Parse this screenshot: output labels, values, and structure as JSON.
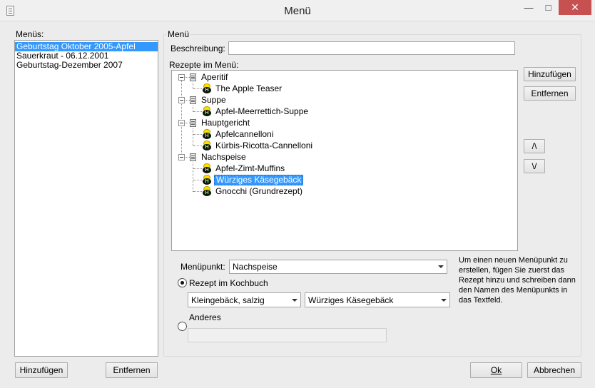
{
  "window": {
    "title": "Menü"
  },
  "menus": {
    "label": "Menüs:",
    "items": [
      {
        "label": "Geburtstag Oktober 2005-Apfel",
        "selected": true
      },
      {
        "label": "Sauerkraut - 06.12.2001",
        "selected": false
      },
      {
        "label": "Geburtstag-Dezember 2007",
        "selected": false
      }
    ],
    "add_label": "Hinzufügen",
    "remove_label": "Entfernen"
  },
  "menu_group": {
    "title": "Menü",
    "description_label": "Beschreibung:",
    "description_value": "",
    "recipes_label": "Rezepte im Menü:",
    "tree": [
      {
        "category": "Aperitif",
        "recipes": [
          {
            "name": "The Apple Teaser",
            "selected": false
          }
        ]
      },
      {
        "category": "Suppe",
        "recipes": [
          {
            "name": "Apfel-Meerrettich-Suppe",
            "selected": false
          }
        ]
      },
      {
        "category": "Hauptgericht",
        "recipes": [
          {
            "name": "Apfelcannelloni",
            "selected": false
          },
          {
            "name": "Kürbis-Ricotta-Cannelloni",
            "selected": false
          }
        ]
      },
      {
        "category": "Nachspeise",
        "recipes": [
          {
            "name": "Apfel-Zimt-Muffins",
            "selected": false
          },
          {
            "name": "Würziges Käsegebäck",
            "selected": true
          },
          {
            "name": "Gnocchi (Grundrezept)",
            "selected": false
          }
        ]
      }
    ],
    "add_label": "Hinzufügen",
    "remove_label": "Entfernen",
    "up_label": "/\\",
    "down_label": "\\/"
  },
  "menu_item": {
    "label": "Menüpunkt:",
    "value": "Nachspeise",
    "help_text": "Um einen neuen Menüpunkt zu erstellen, fügen Sie zuerst das Rezept hinzu und schreiben dann den Namen des Menüpunkts in das Textfeld.",
    "cookbook_option_label": "Rezept im Kochbuch",
    "cookbook_selected": true,
    "category_value": "Kleingebäck, salzig",
    "recipe_value": "Würziges Käsegebäck",
    "other_option_label": "Anderes",
    "other_selected": false,
    "other_value": ""
  },
  "footer": {
    "ok_label": "Ok",
    "cancel_label": "Abbrechen"
  },
  "colors": {
    "selection": "#3399ff",
    "close_button": "#c75050"
  }
}
